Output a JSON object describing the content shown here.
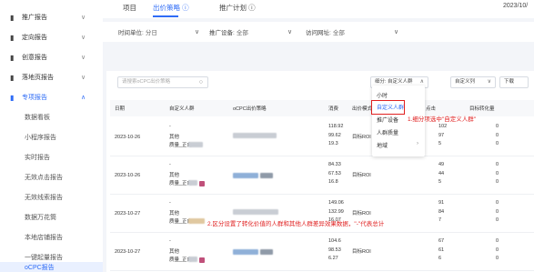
{
  "sidebar": {
    "items": [
      {
        "label": "推广报告",
        "icon": "bar-chart-icon"
      },
      {
        "label": "定向报告",
        "icon": "target-icon"
      },
      {
        "label": "创意报告",
        "icon": "creative-icon"
      },
      {
        "label": "落地页报告",
        "icon": "landing-page-icon"
      },
      {
        "label": "专项报告",
        "icon": "special-report-icon"
      }
    ],
    "subitems": [
      "数据看板",
      "小程序报告",
      "实时报告",
      "无效点击报告",
      "无效线索报告",
      "数据万花筒",
      "本地店铺报告",
      "一键起量报告",
      "oCPC报告"
    ]
  },
  "tabs": [
    "项目",
    "出价策略 ⓘ",
    "推广计划 ⓘ"
  ],
  "date_text": "2023/10/",
  "filters": {
    "time_unit_label": "时间单位:",
    "time_unit_value": "分日",
    "device_label": "推广设备:",
    "device_value": "全部",
    "visit_label": "访问网址:",
    "visit_value": "全部"
  },
  "toolbar": {
    "search_placeholder": "请搜索oCPC出价策略",
    "breakdown_label": "细分: 自定义人群",
    "custom_columns_label": "自定义列",
    "download_label": "下载"
  },
  "table": {
    "headers": [
      "日期",
      "自定义人群",
      "oCPC出价策略",
      "消费",
      "出价模式",
      "点击",
      "目标转化量"
    ],
    "rows": [
      {
        "date": "2023-10-26",
        "group_a": "-",
        "group_b": "其他",
        "group_c": "质量_正向",
        "spend": [
          "118.92",
          "99.62",
          "19.3"
        ],
        "mode": "目标ROI",
        "clicks": [
          "102",
          "97",
          "5"
        ],
        "conv": [
          "0",
          "0",
          "0"
        ]
      },
      {
        "date": "2023-10-26",
        "group_a": "-",
        "group_b": "其他",
        "group_c": "质量_正向",
        "spend": [
          "84.33",
          "67.53",
          "16.8"
        ],
        "mode": "目标ROI",
        "clicks": [
          "49",
          "44",
          "5"
        ],
        "conv": [
          "0",
          "0",
          "0"
        ]
      },
      {
        "date": "2023-10-27",
        "group_a": "-",
        "group_b": "其他",
        "group_c": "质量_正向",
        "spend": [
          "149.06",
          "132.99",
          "16.07"
        ],
        "mode": "目标ROI",
        "clicks": [
          "91",
          "84",
          "7"
        ],
        "conv": [
          "0",
          "0",
          "0"
        ]
      },
      {
        "date": "2023-10-27",
        "group_a": "-",
        "group_b": "其他",
        "group_c": "质量_正向",
        "spend": [
          "104.6",
          "98.53",
          "6.27"
        ],
        "mode": "目标ROI",
        "clicks": [
          "67",
          "61",
          "6"
        ],
        "conv": [
          "0",
          "0",
          "0"
        ]
      }
    ]
  },
  "menu": {
    "items": [
      "小时",
      "自定义人群",
      "推广设备",
      "人群质量",
      "地域"
    ],
    "selected": "自定义人群"
  },
  "annotations": {
    "note1": "1.细分项选中\"自定义人群\"",
    "note2": "2.区分设置了转化价值的人群和其他人群差异效果数据，\"-\"代表总计"
  },
  "colors": {
    "accent": "#2f6cf6",
    "annotation": "#e02020"
  }
}
